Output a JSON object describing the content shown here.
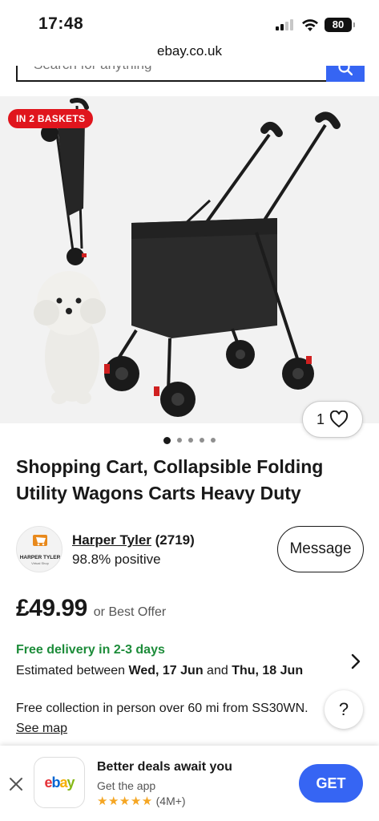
{
  "status_bar": {
    "time": "17:48",
    "battery": "80"
  },
  "browser": {
    "url": "ebay.co.uk"
  },
  "search": {
    "placeholder": "Search for anything"
  },
  "product": {
    "badge": "IN 2 BASKETS",
    "watch_count": "1",
    "image_count": 5,
    "active_image": 1,
    "title": "Shopping Cart, Collapsible Folding Utility Wagons Carts Heavy Duty",
    "price": "£49.99",
    "best_offer": "or Best Offer"
  },
  "seller": {
    "logo_text": "HARPER TYLER",
    "logo_subtext": "Virtual Shop",
    "name": "Harper Tyler",
    "feedback_count": "(2719)",
    "positive": "98.8% positive",
    "message_label": "Message"
  },
  "delivery": {
    "title": "Free delivery in 2-3 days",
    "est_prefix": "Estimated between ",
    "est_start": "Wed, 17 Jun",
    "est_mid": " and ",
    "est_end": "Thu, 18 Jun"
  },
  "collection": {
    "text": "Free collection in person over 60 mi from SS30WN.",
    "link": "See map"
  },
  "help": {
    "label": "?"
  },
  "app_banner": {
    "title": "Better deals await you",
    "subtitle": "Get the app",
    "stars": "★★★★★",
    "rating_count": "(4M+)",
    "get_label": "GET"
  },
  "colors": {
    "accent": "#3665f3",
    "badge": "#e0151d",
    "delivery": "#1d8c3a",
    "stars": "#f5a623"
  }
}
